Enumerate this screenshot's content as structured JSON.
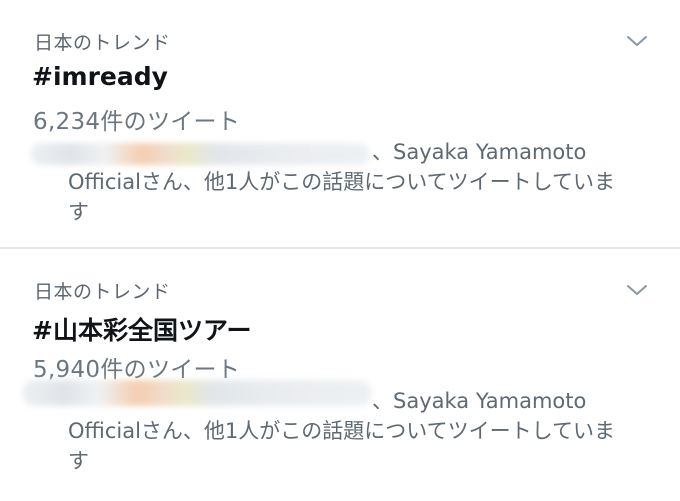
{
  "trends": [
    {
      "context": "日本のトレンド",
      "hashtag": "#imready",
      "tweet_count": "6,234件のツイート",
      "social_line1": "、Sayaka Yamamoto",
      "social_line2": "Officialさん、他1人がこの話題についてツイートしていま",
      "social_line3": "す"
    },
    {
      "context": "日本のトレンド",
      "hashtag": "#山本彩全国ツアー",
      "tweet_count": "5,940件のツイート",
      "social_line1": "、Sayaka Yamamoto",
      "social_line2": "Officialさん、他1人がこの話題についてツイートしていま",
      "social_line3": "す"
    }
  ],
  "icons": {
    "expand": "chevron-down-icon"
  },
  "colors": {
    "divider": "#e6e9ec",
    "secondary_text": "#5b6670",
    "primary_text": "#101418"
  }
}
